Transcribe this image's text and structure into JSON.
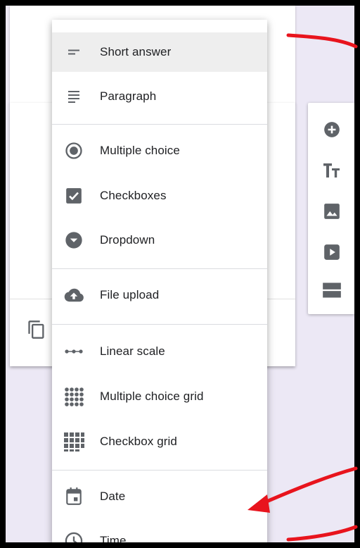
{
  "menu": {
    "items": [
      {
        "label": "Short answer",
        "icon": "short-answer-icon"
      },
      {
        "label": "Paragraph",
        "icon": "paragraph-icon"
      },
      {
        "label": "Multiple choice",
        "icon": "radio-button-icon"
      },
      {
        "label": "Checkboxes",
        "icon": "checkbox-icon"
      },
      {
        "label": "Dropdown",
        "icon": "dropdown-circle-icon"
      },
      {
        "label": "File upload",
        "icon": "cloud-upload-icon"
      },
      {
        "label": "Linear scale",
        "icon": "linear-scale-icon"
      },
      {
        "label": "Multiple choice grid",
        "icon": "dot-grid-icon"
      },
      {
        "label": "Checkbox grid",
        "icon": "square-grid-icon"
      },
      {
        "label": "Date",
        "icon": "calendar-icon"
      },
      {
        "label": "Time",
        "icon": "clock-icon"
      }
    ],
    "selected": "Short answer"
  },
  "toolbar": {
    "tools": [
      "add-question-icon",
      "add-title-icon",
      "add-image-icon",
      "add-video-icon",
      "add-section-icon"
    ]
  },
  "card": {
    "footer_icon": "copy-icon"
  },
  "colors": {
    "background": "#ece8f5",
    "icon": "#5f6368",
    "annotation": "#e8141d",
    "selected_row": "#eeeeee"
  }
}
